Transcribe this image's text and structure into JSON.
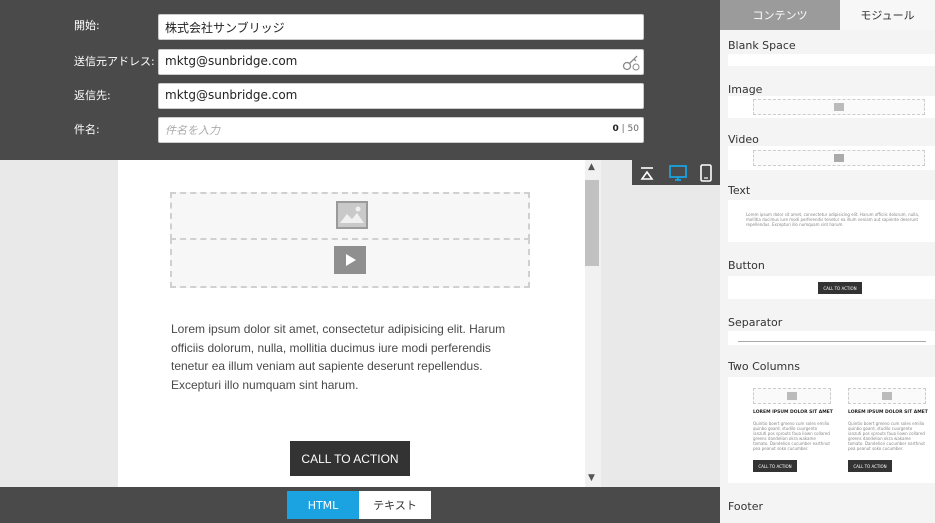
{
  "form": {
    "from_label": "開始:",
    "from_value": "株式会社サンブリッジ",
    "sender_label": "送信元アドレス:",
    "sender_value": "mktg@sunbridge.com",
    "reply_label": "返信先:",
    "reply_value": "mktg@sunbridge.com",
    "subject_label": "件名:",
    "subject_placeholder": "件名を入力",
    "subject_count": "0",
    "subject_max": "50"
  },
  "email": {
    "body_text": "Lorem ipsum dolor sit amet, consectetur adipisicing elit. Harum officiis dolorum, nulla, mollitia ducimus iure modi perferendis tenetur ea illum veniam aut sapiente deserunt repellendus. Excepturi illo numquam sint harum.",
    "cta_label": "CALL TO ACTION"
  },
  "device_icons": [
    "collapse-icon",
    "desktop-icon",
    "mobile-icon"
  ],
  "bottom_tabs": {
    "html": "HTML",
    "text": "テキスト"
  },
  "sidebar": {
    "tab_content": "コンテンツ",
    "tab_module": "モジュール",
    "modules": {
      "blank": "Blank Space",
      "image": "Image",
      "video": "Video",
      "text": "Text",
      "button": "Button",
      "separator": "Separator",
      "two_columns": "Two Columns",
      "footer": "Footer"
    },
    "text_preview": "Lorem ipsum dolor sit amet, consectetur adipisicing elit. Harum officiis dolorum, nulla, mollitia ducimus iure modi perferendis tenetur ea illum veniam aut sapiente deserunt repellendus. Excepturi illo numquam sint harum.",
    "button_preview": "CALL TO ACTION",
    "col_heading": "LOREM IPSUM DOLOR SIT AMET",
    "col_text": "Quintio boert gmeno cum soles emilio quinbo goard, studilo cuurgento ianzuti pos sprouts faua liown collared greens dandelion okra wakame tomato. Dandelion cucumber earthnut pea peanut soko cucumber.",
    "col_button": "CALL TO ACTION"
  },
  "colors": {
    "accent": "#1aa3e0",
    "header_bg": "#4a4a4a",
    "cta_bg": "#333333"
  }
}
